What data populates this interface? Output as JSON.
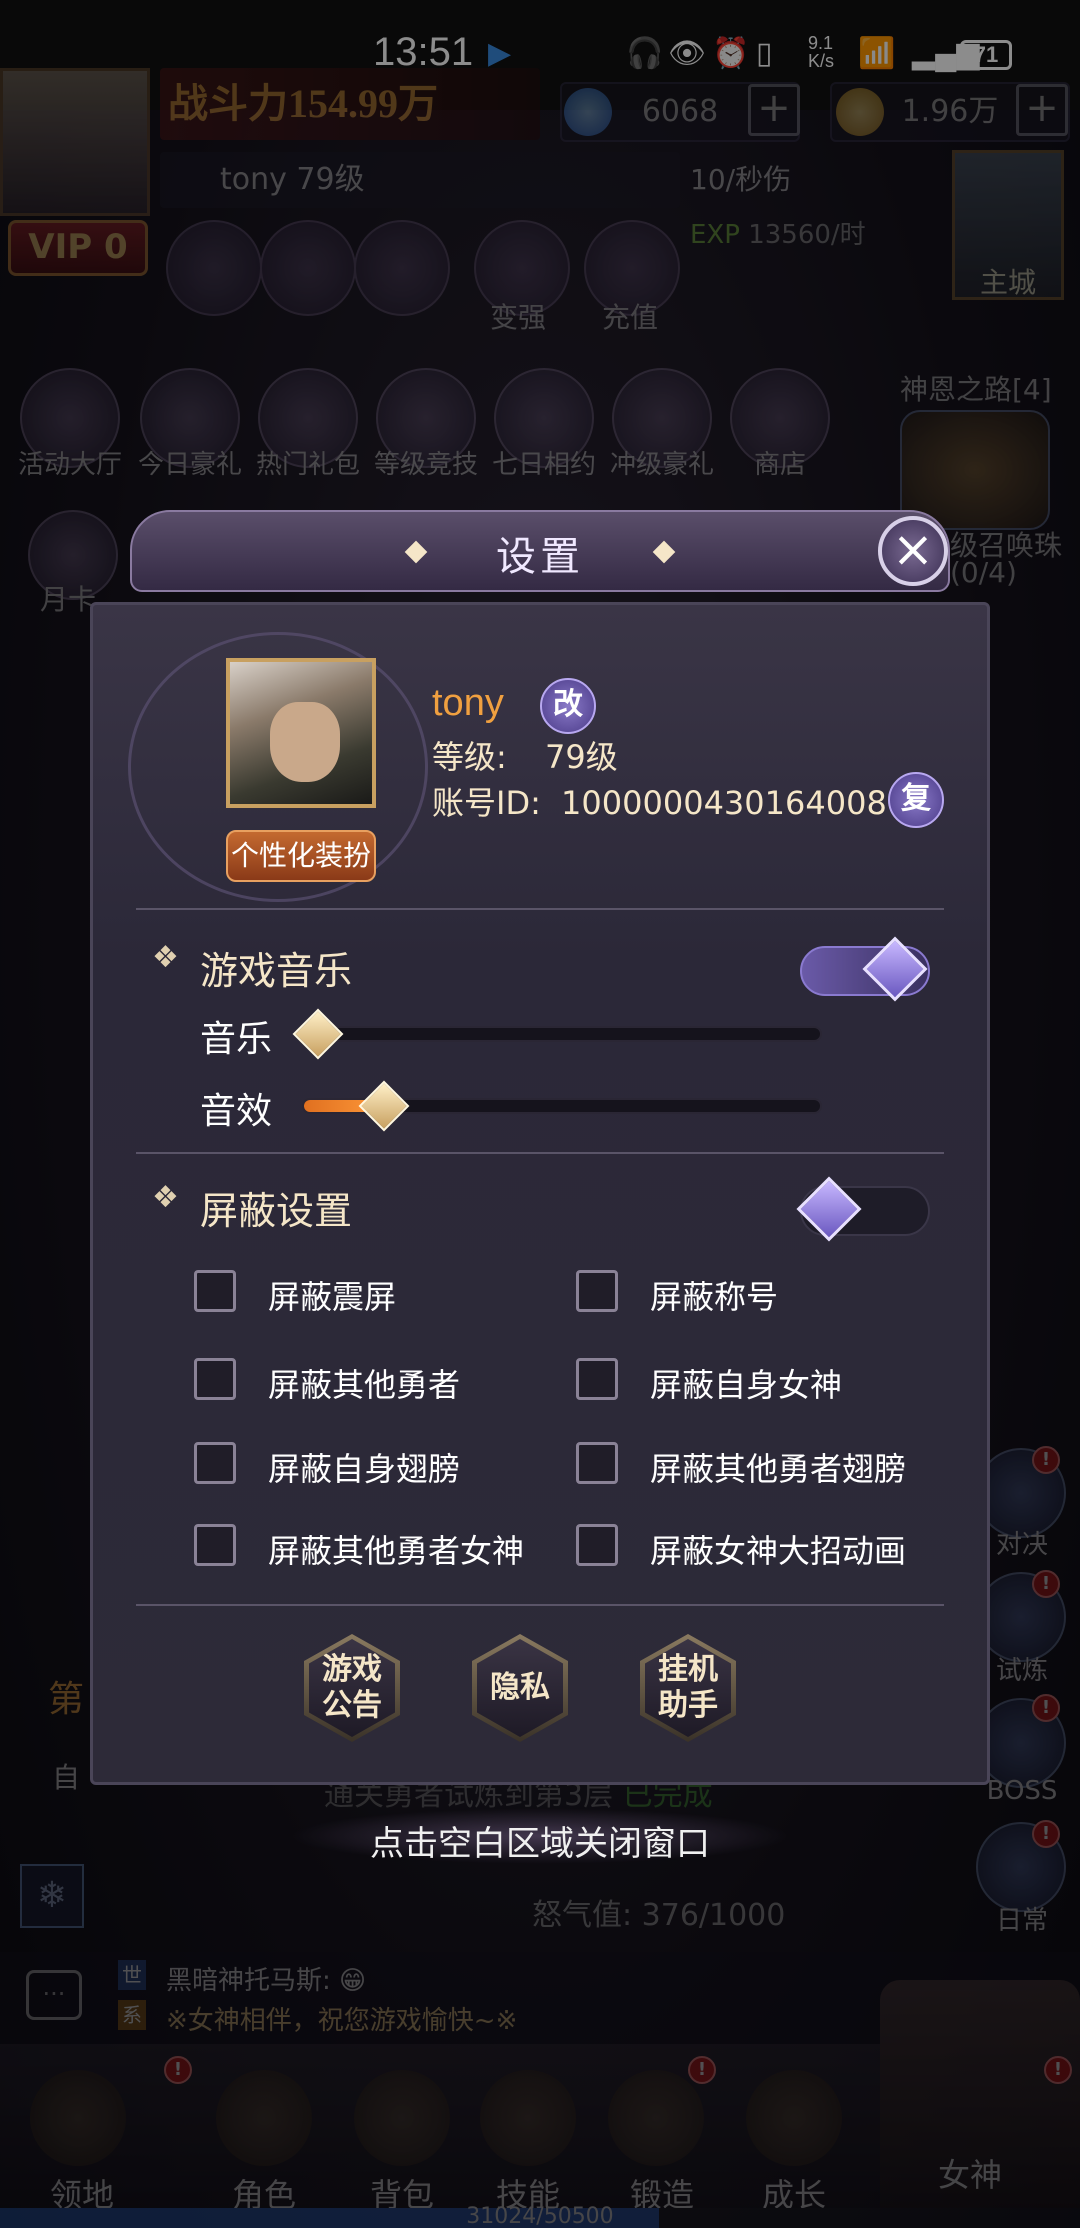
{
  "status_bar": {
    "time": "13:51",
    "net_speed": "9.1\nK/s",
    "battery": "71"
  },
  "hud": {
    "power": "战斗力154.99万",
    "diamonds": "6068",
    "gold": "1.96万",
    "vip": "VIP 0",
    "player_line": "tony 79级",
    "dps": "10/秒伤",
    "exp_label": "EXP",
    "exp_rate": "13560/时",
    "main_city": "主城",
    "icons_row1": [
      "变强",
      "充值"
    ],
    "icons_row2": [
      "活动大厅",
      "今日豪礼",
      "热门礼包",
      "等级竞技",
      "七日相约",
      "冲级豪礼",
      "商店"
    ],
    "god_road": "神恩之路[4]",
    "summon": "级召唤珠",
    "summon_count": "(0/4)",
    "month_card": "月卡",
    "side_buttons": [
      "对决",
      "试炼",
      "BOSS",
      "日常"
    ],
    "chat_tag_world": "世",
    "chat_tag_system": "系",
    "chat_line1": "黑暗神托马斯: 😁",
    "chat_line2": "※女神相伴，祝您游戏愉快~※",
    "bottom_nav": [
      "领地",
      "角色",
      "背包",
      "技能",
      "锻造",
      "成长",
      "女神"
    ],
    "exp_bar": "31024/50500",
    "behind_task": "通关勇者试炼到第3层",
    "behind_task_status": "已完成",
    "rage": "怒气值: 376/1000",
    "stage_hint": "第",
    "auto_hint": "自"
  },
  "dialog": {
    "title": "设置",
    "profile": {
      "name": "tony",
      "rename_label": "改",
      "level_label": "等级:",
      "level_value": "79级",
      "id_label": "账号ID:",
      "id_value": "1000000430164008",
      "copy_label": "复",
      "custom_button": "个性化装扮"
    },
    "music_section": {
      "title": "游戏音乐",
      "enabled": true,
      "music_label": "音乐",
      "music_level": 0.0,
      "sfx_label": "音效",
      "sfx_level": 0.16
    },
    "block_section": {
      "title": "屏蔽设置",
      "enabled": false,
      "options": [
        {
          "label": "屏蔽震屏",
          "checked": false
        },
        {
          "label": "屏蔽称号",
          "checked": false
        },
        {
          "label": "屏蔽其他勇者",
          "checked": false
        },
        {
          "label": "屏蔽自身女神",
          "checked": false
        },
        {
          "label": "屏蔽自身翅膀",
          "checked": false
        },
        {
          "label": "屏蔽其他勇者翅膀",
          "checked": false
        },
        {
          "label": "屏蔽其他勇者女神",
          "checked": false
        },
        {
          "label": "屏蔽女神大招动画",
          "checked": false
        }
      ]
    },
    "bottom_buttons": [
      {
        "line1": "游戏",
        "line2": "公告"
      },
      {
        "line1": "隐私",
        "line2": ""
      },
      {
        "line1": "挂机",
        "line2": "助手"
      }
    ]
  },
  "close_hint": "点击空白区域关闭窗口",
  "colors": {
    "accent_orange": "#f0a040",
    "toggle_on": "#6a5aa8",
    "slider_fill": "#ff9a3a",
    "text_cream": "#f5e6c8"
  }
}
